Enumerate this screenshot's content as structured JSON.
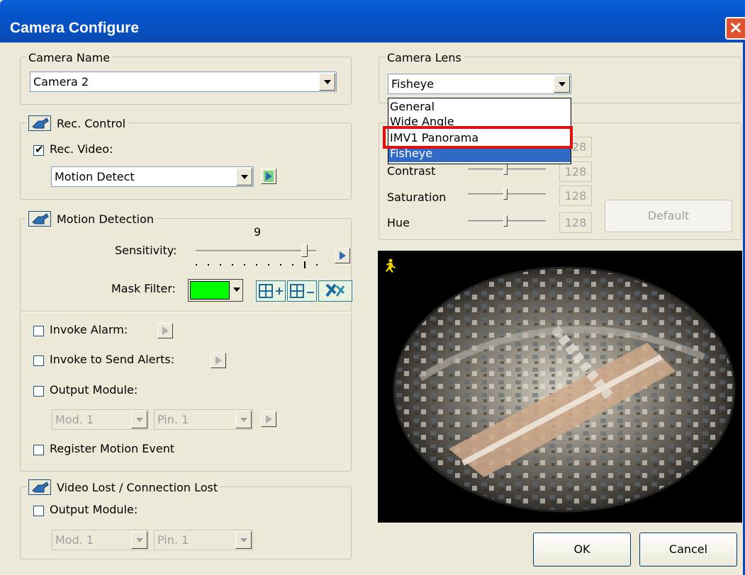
{
  "window": {
    "title": "Camera Configure",
    "close_glyph": "✕"
  },
  "camera_name": {
    "legend": "Camera Name",
    "value": "Camera 2"
  },
  "rec_control": {
    "legend": "Rec. Control",
    "rec_video_label": "Rec. Video:",
    "rec_video_checked": true,
    "mode_value": "Motion Detect"
  },
  "motion_detection": {
    "legend": "Motion Detection",
    "sensitivity_label": "Sensitivity:",
    "sensitivity_value": "9",
    "sensitivity_level": 9,
    "sensitivity_max": 10,
    "mask_filter_label": "Mask Filter:",
    "mask_color": "#00ff00",
    "invoke_alarm_label": "Invoke Alarm:",
    "invoke_alerts_label": "Invoke to Send Alerts:",
    "output_module_label": "Output Module:",
    "module_value": "Mod. 1",
    "pin_value": "Pin. 1",
    "register_event_label": "Register Motion Event"
  },
  "video_lost": {
    "legend": "Video Lost / Connection Lost",
    "output_module_label": "Output Module:",
    "module_value": "Mod. 1",
    "pin_value": "Pin. 1"
  },
  "camera_lens": {
    "legend": "Camera Lens",
    "selected": "Fisheye",
    "options": [
      "General",
      "Wide Angle",
      "IMV1 Panorama",
      "Fisheye"
    ],
    "highlighted_option": "IMV1 Panorama",
    "highlight_color": "#e01010"
  },
  "adjust": {
    "brightness_value": "128",
    "contrast_label": "Contrast",
    "contrast_value": "128",
    "saturation_label": "Saturation",
    "saturation_value": "128",
    "hue_label": "Hue",
    "hue_value": "128",
    "default_label": "Default"
  },
  "buttons": {
    "ok": "OK",
    "cancel": "Cancel"
  }
}
